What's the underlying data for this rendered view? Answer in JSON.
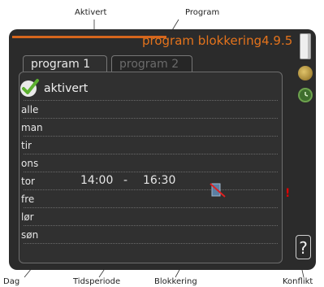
{
  "callouts": {
    "aktivert": "Aktivert",
    "program": "Program",
    "dag": "Dag",
    "tidsperiode": "Tidsperiode",
    "blokkering": "Blokkering",
    "konflikt": "Konflikt"
  },
  "screen": {
    "title": "program blokkering4.9.5",
    "help_label": "?"
  },
  "tabs": [
    {
      "label": "program 1",
      "active": true
    },
    {
      "label": "program 2",
      "active": false
    }
  ],
  "schedule": {
    "activated_label": "aktivert",
    "days": [
      "alle",
      "man",
      "tir",
      "ons",
      "tor",
      "fre",
      "lør",
      "søn"
    ],
    "entry": {
      "day": "tor",
      "start": "14:00",
      "separator": "-",
      "end": "16:30"
    },
    "conflict_mark": "!"
  },
  "colors": {
    "accent": "#e4731c",
    "background": "#2b2b2b",
    "check": "#5cb030",
    "conflict": "#e00000"
  },
  "icons": [
    "check-icon",
    "block-icon",
    "thermometer-icon",
    "settings-icon",
    "clock-icon",
    "help-icon"
  ]
}
